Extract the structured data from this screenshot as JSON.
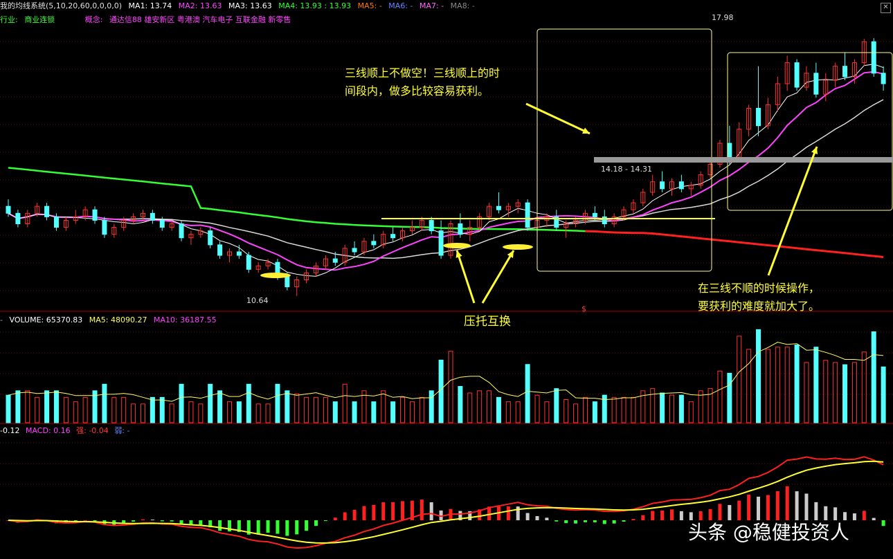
{
  "header": {
    "system": "我的均线系统(5,10,20,60,0,0,0,0)",
    "ma": [
      {
        "label": "MA1: 13.74",
        "color": "#ffffff"
      },
      {
        "label": "MA2: 13.63",
        "color": "#ff44ff"
      },
      {
        "label": "MA3: 13.63",
        "color": "#ffffff"
      },
      {
        "label": "MA4: 13.93 : 13.93",
        "color": "#33ff33"
      },
      {
        "label": "MA5: -",
        "color": "#ff7700"
      },
      {
        "label": "MA6: -",
        "color": "#6688ff"
      },
      {
        "label": "MA7: -",
        "color": "#ff66ff"
      },
      {
        "label": "MA8: -",
        "color": "#888888"
      }
    ],
    "industry_label": "行业:",
    "industry": "商业连锁",
    "concept_label": "概念:",
    "concepts": "通达信88 雄安新区 粤港澳 汽车电子 互联金融 新零售",
    "close_icon": "close-icon"
  },
  "annotations": {
    "top_note_line1": "三线顺上不做空！三线顺上的时",
    "top_note_line2": "间段内，做多比较容易获利。",
    "support_resist": "压托互换",
    "bottom_note_line1": "在三线不顺的时候操作，",
    "bottom_note_line2": "要获利的难度就加大了。",
    "price_high": "17.98",
    "price_low": "10.64",
    "gap_label": "14.18 - 14.31",
    "dollar_marker": "$"
  },
  "volume_header": {
    "label": "VOLUME: 65370.83",
    "ma5": "MA5: 48090.27",
    "ma10": "MA10: 36187.55"
  },
  "macd_header": {
    "value": "-0.12",
    "macd": "MACD: 0.16",
    "strong": "强: -0.04",
    "weak": "弱: -"
  },
  "watermark": "头条 @稳健投资人",
  "colors": {
    "up": "#ff3333",
    "down": "#54ffff",
    "ma5": "#ffffff",
    "ma10": "#ff44ff",
    "ma20": "#d9d9d9",
    "ma60": "#33ff33",
    "ma60_late": "#ff2020",
    "note": "#ffff33"
  },
  "chart_data": [
    {
      "type": "candlestick",
      "title": "我的均线系统(5,10,20,60,0,0,0,0)",
      "ylim": [
        10.3,
        18.3
      ],
      "candles": [
        [
          13.2,
          13.4,
          12.9,
          13.0
        ],
        [
          13.0,
          13.1,
          12.6,
          12.7
        ],
        [
          12.7,
          13.1,
          12.6,
          13.0
        ],
        [
          13.0,
          13.3,
          12.9,
          13.2
        ],
        [
          13.2,
          13.3,
          12.8,
          12.9
        ],
        [
          12.9,
          13.0,
          12.5,
          12.6
        ],
        [
          12.6,
          12.9,
          12.5,
          12.8
        ],
        [
          12.8,
          13.1,
          12.7,
          12.9
        ],
        [
          12.9,
          13.2,
          12.8,
          13.1
        ],
        [
          13.1,
          13.2,
          12.7,
          12.8
        ],
        [
          12.8,
          12.9,
          12.3,
          12.4
        ],
        [
          12.4,
          12.7,
          12.3,
          12.6
        ],
        [
          12.6,
          12.9,
          12.5,
          12.8
        ],
        [
          12.8,
          13.0,
          12.7,
          12.9
        ],
        [
          12.9,
          13.1,
          12.8,
          13.0
        ],
        [
          13.0,
          13.1,
          12.7,
          12.8
        ],
        [
          12.8,
          12.9,
          12.5,
          12.6
        ],
        [
          12.6,
          12.8,
          12.5,
          12.7
        ],
        [
          12.7,
          12.8,
          12.2,
          12.3
        ],
        [
          12.3,
          12.5,
          12.1,
          12.4
        ],
        [
          12.4,
          12.6,
          12.3,
          12.5
        ],
        [
          12.5,
          12.6,
          12.0,
          12.1
        ],
        [
          12.1,
          12.2,
          11.7,
          11.8
        ],
        [
          11.8,
          12.0,
          11.6,
          11.9
        ],
        [
          11.9,
          12.1,
          11.7,
          11.8
        ],
        [
          11.8,
          11.9,
          11.3,
          11.4
        ],
        [
          11.4,
          11.6,
          11.3,
          11.5
        ],
        [
          11.5,
          11.7,
          11.4,
          11.6
        ],
        [
          11.6,
          11.7,
          11.1,
          11.2
        ],
        [
          11.2,
          11.3,
          10.8,
          10.9
        ],
        [
          10.9,
          11.2,
          10.64,
          11.1
        ],
        [
          11.1,
          11.4,
          11.0,
          11.3
        ],
        [
          11.3,
          11.6,
          11.2,
          11.5
        ],
        [
          11.5,
          11.8,
          11.4,
          11.7
        ],
        [
          11.7,
          11.9,
          11.5,
          11.6
        ],
        [
          11.6,
          12.1,
          11.5,
          12.0
        ],
        [
          12.0,
          12.2,
          11.8,
          11.9
        ],
        [
          11.9,
          12.3,
          11.8,
          12.2
        ],
        [
          12.2,
          12.4,
          12.0,
          12.1
        ],
        [
          12.1,
          12.5,
          12.0,
          12.4
        ],
        [
          12.4,
          12.6,
          12.2,
          12.3
        ],
        [
          12.3,
          12.6,
          12.2,
          12.5
        ],
        [
          12.5,
          12.8,
          12.4,
          12.6
        ],
        [
          12.6,
          12.9,
          12.5,
          12.8
        ],
        [
          12.8,
          12.9,
          12.4,
          12.5
        ],
        [
          12.5,
          12.8,
          11.7,
          11.8
        ],
        [
          11.8,
          12.8,
          11.7,
          12.7
        ],
        [
          12.7,
          13.0,
          12.3,
          12.4
        ],
        [
          12.4,
          12.8,
          12.2,
          12.6
        ],
        [
          12.6,
          13.0,
          12.5,
          12.9
        ],
        [
          12.9,
          13.3,
          12.8,
          13.2
        ],
        [
          13.2,
          13.6,
          13.0,
          13.1
        ],
        [
          13.1,
          13.3,
          12.9,
          13.2
        ],
        [
          13.2,
          13.4,
          13.0,
          13.3
        ],
        [
          13.3,
          13.4,
          12.5,
          12.6
        ],
        [
          12.6,
          12.9,
          12.4,
          12.8
        ],
        [
          12.8,
          13.0,
          12.6,
          12.9
        ],
        [
          12.9,
          13.1,
          12.5,
          12.6
        ],
        [
          12.6,
          12.8,
          12.3,
          12.7
        ],
        [
          12.7,
          12.9,
          12.6,
          12.8
        ],
        [
          12.8,
          13.1,
          12.7,
          13.0
        ],
        [
          13.0,
          13.2,
          12.8,
          12.9
        ],
        [
          12.9,
          13.1,
          12.6,
          12.7
        ],
        [
          12.7,
          13.0,
          12.6,
          12.9
        ],
        [
          12.9,
          13.2,
          12.8,
          13.1
        ],
        [
          13.1,
          13.4,
          13.0,
          13.3
        ],
        [
          13.3,
          13.7,
          13.2,
          13.6
        ],
        [
          13.6,
          14.1,
          13.5,
          13.9
        ],
        [
          13.9,
          14.2,
          13.6,
          13.7
        ],
        [
          13.7,
          14.0,
          13.5,
          13.9
        ],
        [
          13.9,
          14.1,
          13.6,
          13.7
        ],
        [
          13.7,
          13.9,
          13.5,
          13.8
        ],
        [
          13.8,
          14.2,
          13.7,
          14.1
        ],
        [
          14.1,
          14.6,
          14.0,
          14.4
        ],
        [
          14.4,
          15.1,
          14.3,
          15.0
        ],
        [
          15.0,
          15.5,
          14.4,
          14.6
        ],
        [
          14.6,
          15.6,
          14.5,
          15.4
        ],
        [
          15.4,
          16.1,
          15.2,
          16.0
        ],
        [
          16.0,
          17.2,
          15.2,
          15.5
        ],
        [
          15.5,
          16.3,
          15.4,
          16.1
        ],
        [
          16.1,
          16.9,
          15.9,
          16.7
        ],
        [
          16.7,
          17.5,
          16.5,
          17.3
        ],
        [
          17.3,
          17.4,
          16.5,
          16.6
        ],
        [
          16.6,
          17.2,
          16.5,
          17.0
        ],
        [
          17.0,
          17.3,
          16.3,
          16.4
        ],
        [
          16.4,
          17.0,
          16.2,
          16.8
        ],
        [
          16.8,
          17.3,
          16.6,
          17.2
        ],
        [
          17.2,
          17.6,
          16.8,
          16.9
        ],
        [
          16.9,
          17.4,
          16.7,
          17.3
        ],
        [
          17.3,
          17.98,
          17.2,
          17.9
        ],
        [
          17.9,
          18.0,
          16.9,
          17.0
        ],
        [
          17.0,
          17.2,
          16.5,
          16.7
        ]
      ]
    }
  ]
}
